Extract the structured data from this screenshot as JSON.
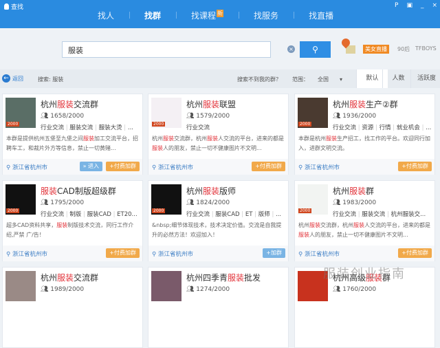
{
  "window": {
    "title": "查找",
    "controls": [
      "P",
      "▣",
      "_",
      "×"
    ]
  },
  "nav": {
    "tabs": [
      {
        "label": "找人"
      },
      {
        "label": "找群",
        "active": true
      },
      {
        "label": "找课程",
        "badge": "新"
      },
      {
        "label": "找服务"
      },
      {
        "label": "找直播"
      }
    ]
  },
  "search": {
    "value": "服装",
    "clear": "×",
    "button": "⚲"
  },
  "hot": {
    "badge": "美女直播",
    "tags": [
      "90后",
      "TFBOYS"
    ]
  },
  "filter": {
    "back": "返回",
    "query": "搜索: 服装",
    "not_found": "搜索不到我的群？",
    "range_label": "范围：",
    "range_value": "全国",
    "sorts": [
      "默认",
      "人数",
      "活跃度"
    ]
  },
  "cards": [
    {
      "pre": "杭州",
      "hl": "服装",
      "post": "交流群",
      "members": "1658/2000",
      "level": "2000",
      "thumb": "#5a6e66",
      "tags": [
        "行业交流",
        "服装交流",
        "服装大烫",
        "..."
      ],
      "desc": [
        {
          "t": "本群是提供杭州五堡至九堡之间"
        },
        {
          "t": "服装",
          "hl": 1
        },
        {
          "t": "加工交流平台，招聘车工，和裁片外方等信息，禁止一切黄赌..."
        }
      ],
      "loc": "浙江省杭州市",
      "enter": "» 进入",
      "btn": "+付费加群"
    },
    {
      "pre": "杭州",
      "hl": "服装",
      "post": "联盟",
      "members": "1579/2000",
      "level": "2000",
      "thumb": "#f4f0f4",
      "tags": [
        "行业交流"
      ],
      "desc": [
        {
          "t": "杭州"
        },
        {
          "t": "服装",
          "hl": 1
        },
        {
          "t": "交流群，杭州"
        },
        {
          "t": "服装",
          "hl": 1
        },
        {
          "t": "人交流的平台，进来的都是"
        },
        {
          "t": "服装",
          "hl": 1
        },
        {
          "t": "人的朋友，禁止一切不健康图片不文明..."
        }
      ],
      "loc": "浙江省杭州市",
      "btn": "+付费加群"
    },
    {
      "pre": "杭州",
      "hl": "服装",
      "post": "生产②群",
      "members": "1936/2000",
      "level": "2000",
      "thumb": "#4a3a30",
      "tags": [
        "行业交流",
        "资源",
        "行情",
        "就业机会",
        "..."
      ],
      "desc": [
        {
          "t": "本群是杭州"
        },
        {
          "t": "服装",
          "hl": 1
        },
        {
          "t": "生产招工，找工作的平台。欢迎同行加入，进群文明交流。"
        }
      ],
      "loc": "浙江省杭州市",
      "btn": "+付费加群"
    },
    {
      "pre": "",
      "hl": "服装",
      "post": "CAD制版超级群",
      "members": "1795/2000",
      "level": "2000",
      "thumb": "#111",
      "tags": [
        "行业交流",
        "制版",
        "服装CAD",
        "ET20..."
      ],
      "desc": [
        {
          "t": "超多CAD资料共享，"
        },
        {
          "t": "服装",
          "hl": 1
        },
        {
          "t": "制版技术交流，同行工作介绍,严禁 广/告！"
        }
      ],
      "loc": "浙江省杭州市",
      "btn": "+付费加群"
    },
    {
      "pre": "杭州",
      "hl": "服装",
      "post": "版师",
      "members": "1824/2000",
      "level": "2000",
      "thumb": "#111",
      "tags": [
        "行业交流",
        "服装CAD",
        "ET",
        "版师",
        "..."
      ],
      "desc": [
        {
          "t": "&nbsp;细节体现技术，技术决定价值。交流是自我提升的必然方法！欢迎加入！"
        }
      ],
      "loc": "浙江省杭州市",
      "join": "+加群"
    },
    {
      "pre": "杭州",
      "hl": "服装",
      "post": "群",
      "members": "1983/2000",
      "level": "2000",
      "thumb": "#f2f4f2",
      "tags": [
        "行业交流",
        "服装交流",
        "杭州服装交..."
      ],
      "desc": [
        {
          "t": "杭州"
        },
        {
          "t": "服装",
          "hl": 1
        },
        {
          "t": "交流群，杭州"
        },
        {
          "t": "服装",
          "hl": 1
        },
        {
          "t": "人交流的平台，进来的都是"
        },
        {
          "t": "服装",
          "hl": 1
        },
        {
          "t": "人的朋友，禁止一切不健康图片不文明..."
        }
      ],
      "loc": "浙江省杭州市",
      "btn": "+付费加群"
    },
    {
      "pre": "杭州",
      "hl": "服装",
      "post": "交流群",
      "members": "1989/2000",
      "thumb": "#9a8a86",
      "tags": [],
      "desc": []
    },
    {
      "pre": "杭州四季青",
      "hl": "服装",
      "post": "批发",
      "members": "1274/2000",
      "thumb": "#7a5a6a",
      "tags": [],
      "desc": []
    },
    {
      "pre": "杭州高级",
      "hl": "服装",
      "post": "群",
      "members": "1760/2000",
      "thumb": "#c8321e",
      "tags": [],
      "desc": []
    }
  ],
  "watermark": "服装创业指南"
}
